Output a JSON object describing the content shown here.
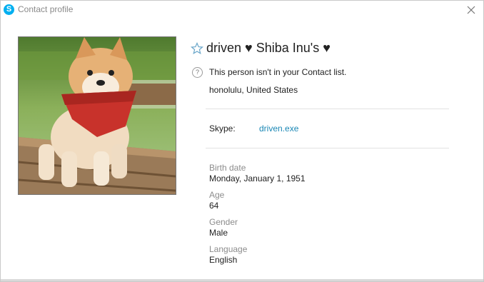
{
  "window": {
    "title": "Contact profile",
    "app_icon_letter": "S",
    "accent_color": "#00aff0"
  },
  "profile": {
    "photo_subject": "Shiba Inu puppy wearing a red bandana on a wooden bench",
    "display_name": "driven ♥ Shiba Inu's ♥",
    "favorite_icon": "star-outline-icon",
    "status_icon": "question-circle-icon",
    "contact_status": "This person isn't in your Contact list.",
    "location": "honolulu, United States",
    "skype_label": "Skype:",
    "skype_id": "driven.exe",
    "link_color": "#1a87b5"
  },
  "details": [
    {
      "label": "Birth date",
      "value": "Monday, January 1, 1951"
    },
    {
      "label": "Age",
      "value": "64"
    },
    {
      "label": "Gender",
      "value": "Male"
    },
    {
      "label": "Language",
      "value": "English"
    }
  ]
}
